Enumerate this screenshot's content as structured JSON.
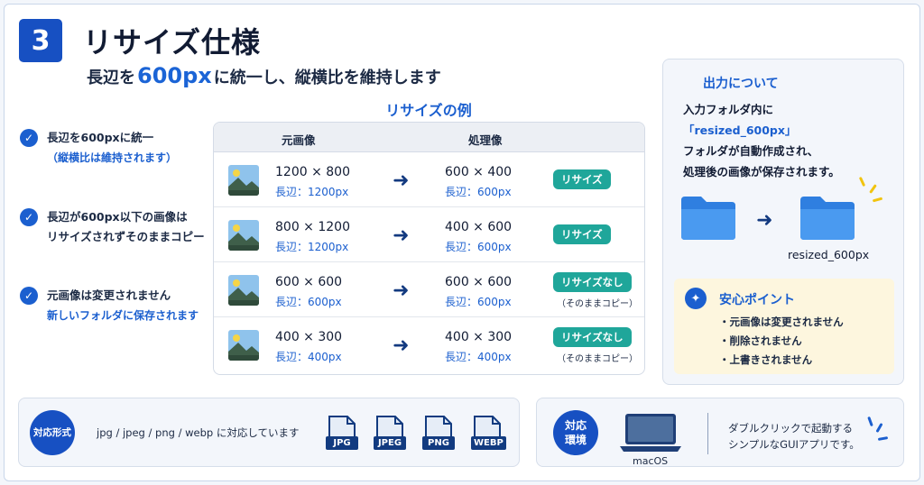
{
  "header": {
    "step_number": "3",
    "title": "リサイズ仕様",
    "subtitle_pre": "長辺を",
    "subtitle_value": "600px",
    "subtitle_post": "に統一し、縦横比を維持します"
  },
  "points": [
    {
      "text": "長辺を600pxに統一",
      "sub": "（縦横比は維持されます）"
    },
    {
      "text": "長辺が600px以下の画像は",
      "text2": "リサイズされずそのままコピー"
    },
    {
      "text": "元画像は変更されません",
      "sub": "新しいフォルダに保存されます"
    }
  ],
  "example": {
    "title": "リサイズの例",
    "col_original": "元画像",
    "col_processed": "処理像",
    "rows": [
      {
        "orig_size": "1200 × 800",
        "orig_long": "長辺：1200px",
        "new_size": "600 × 400",
        "new_long": "長辺：600px",
        "badge": "リサイズ",
        "note": ""
      },
      {
        "orig_size": "800 × 1200",
        "orig_long": "長辺：1200px",
        "new_size": "400 × 600",
        "new_long": "長辺：600px",
        "badge": "リサイズ",
        "note": ""
      },
      {
        "orig_size": "600 × 600",
        "orig_long": "長辺：600px",
        "new_size": "600 × 600",
        "new_long": "長辺：600px",
        "badge": "リサイズなし",
        "note": "（そのままコピー）"
      },
      {
        "orig_size": "400 × 300",
        "orig_long": "長辺：400px",
        "new_size": "400 × 300",
        "new_long": "長辺：400px",
        "badge": "リサイズなし",
        "note": "（そのままコピー）"
      }
    ]
  },
  "output": {
    "title": "出力について",
    "line1": "入力フォルダ内に",
    "line2": "「resized_600px」",
    "line3": "フォルダが自動作成され、",
    "line4": "処理後の画像が保存されます。",
    "folder_label": "resized_600px"
  },
  "safety": {
    "title": "安心ポイント",
    "items": [
      "・元画像は変更されません",
      "・削除されません",
      "・上書きされません"
    ]
  },
  "formats": {
    "badge": "対応形式",
    "text": "jpg / jpeg / png / webp に対応しています",
    "types": [
      "JPG",
      "JPEG",
      "PNG",
      "WEBP"
    ]
  },
  "environment": {
    "badge_line1": "対応",
    "badge_line2": "環境",
    "os": "macOS",
    "line1": "ダブルクリックで起動する",
    "line2": "シンプルなGUIアプリです。"
  },
  "colors": {
    "accent": "#1b5fcf",
    "badge_teal": "#1fa69a",
    "navy": "#123b80",
    "folder": "#3b8de8"
  }
}
